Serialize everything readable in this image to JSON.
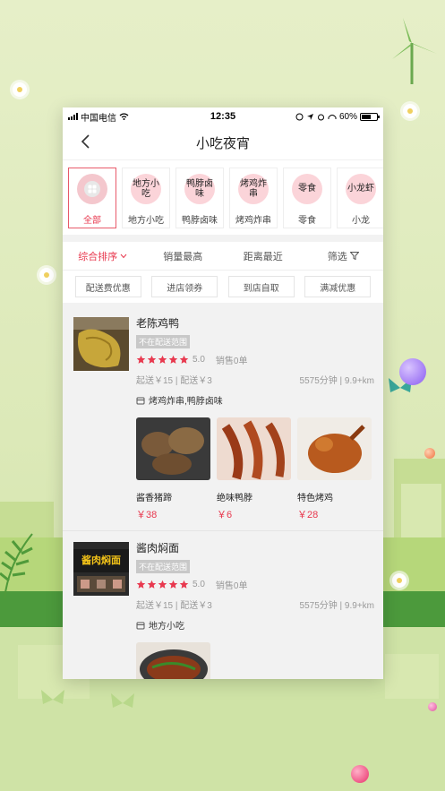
{
  "status_bar": {
    "carrier": "中国电信",
    "time": "12:35",
    "battery": "60%",
    "battery_level": 0.6
  },
  "nav": {
    "title": "小吃夜宵"
  },
  "categories": [
    {
      "icon_text": "",
      "label": "全部",
      "icon": "grid-icon"
    },
    {
      "icon_text": "地方小吃",
      "label": "地方小吃"
    },
    {
      "icon_text": "鸭脖卤味",
      "label": "鸭脖卤味"
    },
    {
      "icon_text": "烤鸡炸串",
      "label": "烤鸡炸串"
    },
    {
      "icon_text": "零食",
      "label": "零食"
    },
    {
      "icon_text": "小龙虾",
      "label": "小龙"
    }
  ],
  "sort": {
    "default_label": "综合排序",
    "sales_label": "销量最高",
    "distance_label": "距离最近",
    "filter_label": "筛选"
  },
  "filters": [
    "配送费优惠",
    "进店领券",
    "到店自取",
    "满减优惠"
  ],
  "shops": [
    {
      "name": "老陈鸡鸭",
      "tag": "不在配送范围",
      "rating": 5.0,
      "score": "5.0",
      "sales": "销售0单",
      "delivery": "起送￥15 | 配送￥3",
      "distance": "5575分钟 | 9.9+km",
      "kind": "烤鸡炸串,鸭脖卤味",
      "dishes": [
        {
          "name": "酱香猪蹄",
          "price": "￥38"
        },
        {
          "name": "绝味鸭脖",
          "price": "￥6"
        },
        {
          "name": "特色烤鸡",
          "price": "￥28"
        }
      ]
    },
    {
      "name": "酱肉焖面",
      "tag": "不在配送范围",
      "rating": 5.0,
      "score": "5.0",
      "sales": "销售0单",
      "delivery": "起送￥15 | 配送￥3",
      "distance": "5575分钟 | 9.9+km",
      "kind": "地方小吃",
      "thumb_sign": "酱肉焖面",
      "dishes": [
        {
          "name": "",
          "price": ""
        }
      ]
    }
  ],
  "colors": {
    "accent": "#e8394f",
    "tag_bg": "#c8c8c8",
    "category_circle": "#fbd4d9",
    "background": "#dde9b9"
  }
}
